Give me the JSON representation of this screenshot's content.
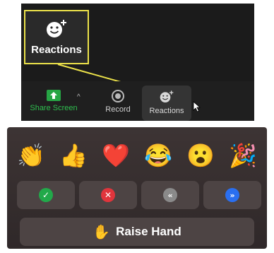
{
  "toolbar": {
    "callout_label": "Reactions",
    "share_screen_label": "Share Screen",
    "record_label": "Record",
    "reactions_label": "Reactions",
    "share_caret": "^"
  },
  "picker": {
    "emojis": [
      {
        "icon": "clapping-hands",
        "glyph": "👏"
      },
      {
        "icon": "thumbs-up",
        "glyph": "👍"
      },
      {
        "icon": "red-heart",
        "glyph": "❤️"
      },
      {
        "icon": "tears-of-joy",
        "glyph": "😂"
      },
      {
        "icon": "surprised-face",
        "glyph": "😮"
      },
      {
        "icon": "party-popper",
        "glyph": "🎉"
      }
    ],
    "actions": [
      {
        "icon": "yes-check",
        "glyph": "✓",
        "color": "#22a94a"
      },
      {
        "icon": "no-x",
        "glyph": "✕",
        "color": "#e0353c"
      },
      {
        "icon": "go-slower",
        "glyph": "«",
        "color": "#8a8a8a"
      },
      {
        "icon": "go-faster",
        "glyph": "»",
        "color": "#2a6ff0"
      }
    ],
    "raise_hand_glyph": "✋",
    "raise_hand_label": "Raise Hand"
  }
}
